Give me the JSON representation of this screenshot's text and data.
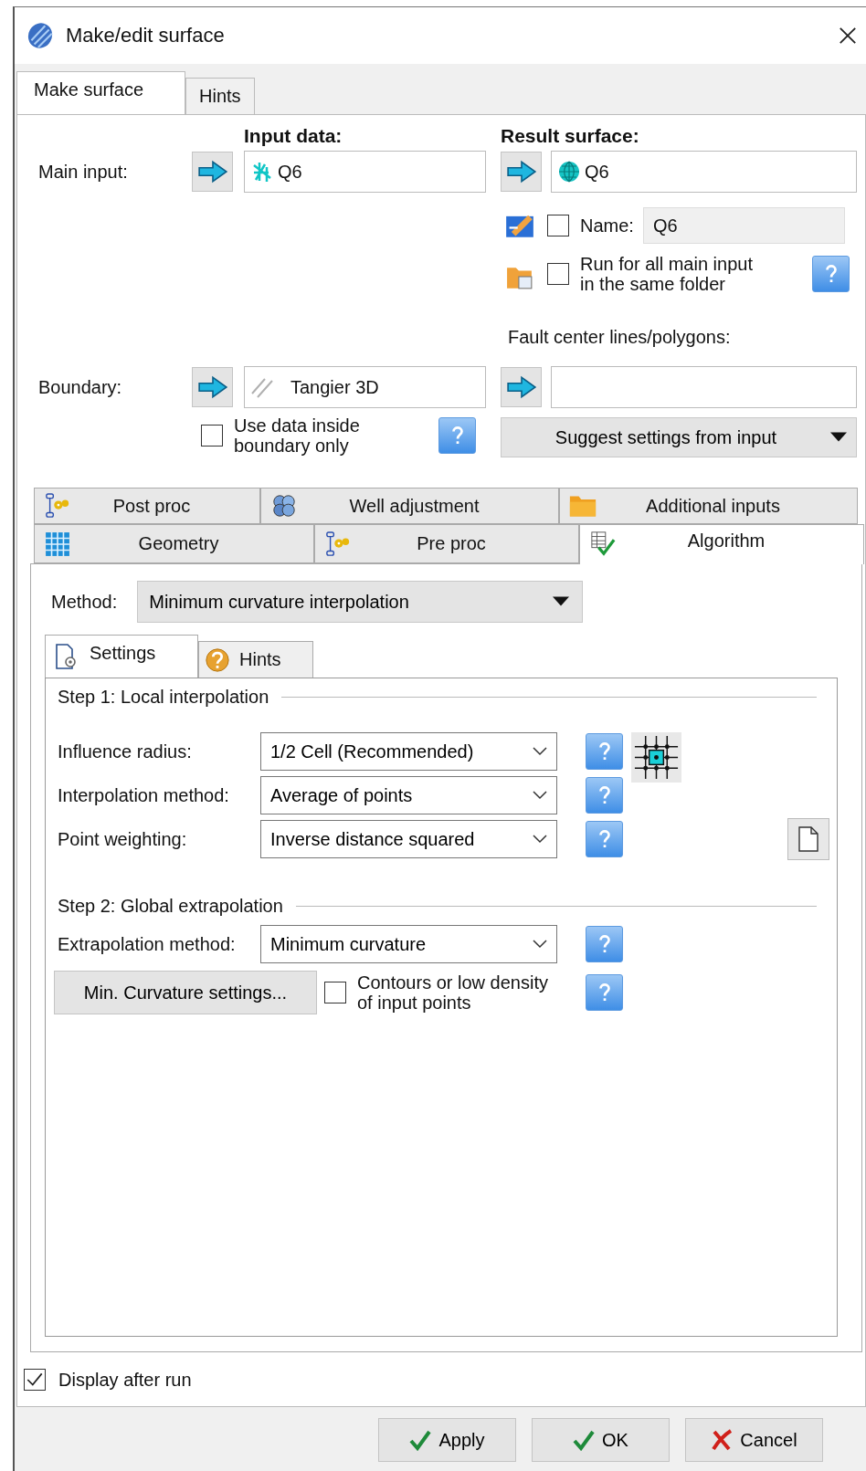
{
  "window": {
    "title": "Make/edit surface"
  },
  "tabs": [
    {
      "label": "Make surface",
      "selected": true
    },
    {
      "label": "Hints",
      "selected": false
    }
  ],
  "input_header": "Input data:",
  "result_header": "Result surface:",
  "main_input": {
    "label": "Main input:",
    "input": "Q6",
    "result": "Q6"
  },
  "name": {
    "checked": false,
    "label": "Name:",
    "value": "Q6"
  },
  "run_all": {
    "checked": false,
    "label": "Run for all main input\nin the same folder"
  },
  "fault": {
    "label": "Fault center lines/polygons:"
  },
  "boundary": {
    "label": "Boundary:",
    "value": "Tangier 3D"
  },
  "use_inside": {
    "checked": false,
    "label": "Use data inside\nboundary only"
  },
  "suggest": {
    "label": "Suggest settings from input"
  },
  "section_tab_rows": [
    {
      "tabs": [
        {
          "label": "Post proc",
          "selected": false,
          "kind": "gears"
        },
        {
          "label": "Well adjustment",
          "selected": false,
          "kind": "spheres"
        },
        {
          "label": "Additional inputs",
          "selected": false,
          "kind": "folder"
        }
      ]
    },
    {
      "tabs": [
        {
          "label": "Geometry",
          "selected": false,
          "kind": "grid"
        },
        {
          "label": "Pre proc",
          "selected": false,
          "kind": "gears"
        },
        {
          "label": "Algorithm",
          "selected": true,
          "kind": "check-table"
        }
      ]
    }
  ],
  "method": {
    "label": "Method:",
    "value": "Minimum curvature interpolation"
  },
  "sub_tabs": [
    {
      "label": "Settings",
      "selected": true,
      "kind": "settings"
    },
    {
      "label": "Hints",
      "selected": false,
      "kind": "hint"
    }
  ],
  "step1": {
    "title": "Step 1: Local interpolation",
    "rows": [
      {
        "label": "Influence radius:",
        "value": "1/2 Cell (Recommended)",
        "kind": "grid"
      },
      {
        "label": "Interpolation method:",
        "value": "Average of points",
        "kind": "plain"
      },
      {
        "label": "Point weighting:",
        "value": "Inverse distance squared",
        "kind": "document"
      }
    ]
  },
  "step2": {
    "title": "Step 2: Global extrapolation",
    "rows": [
      {
        "label": "Extrapolation method:",
        "value": "Minimum curvature"
      }
    ]
  },
  "min_curvature_button": "Min. Curvature settings...",
  "contours": {
    "checked": false,
    "label": "Contours or low density\nof input points"
  },
  "display_after_run": {
    "checked": true,
    "label": "Display after run"
  },
  "buttons": [
    {
      "label": "Apply",
      "kind": "check"
    },
    {
      "label": "OK",
      "kind": "check"
    },
    {
      "label": "Cancel",
      "kind": "cross"
    }
  ]
}
